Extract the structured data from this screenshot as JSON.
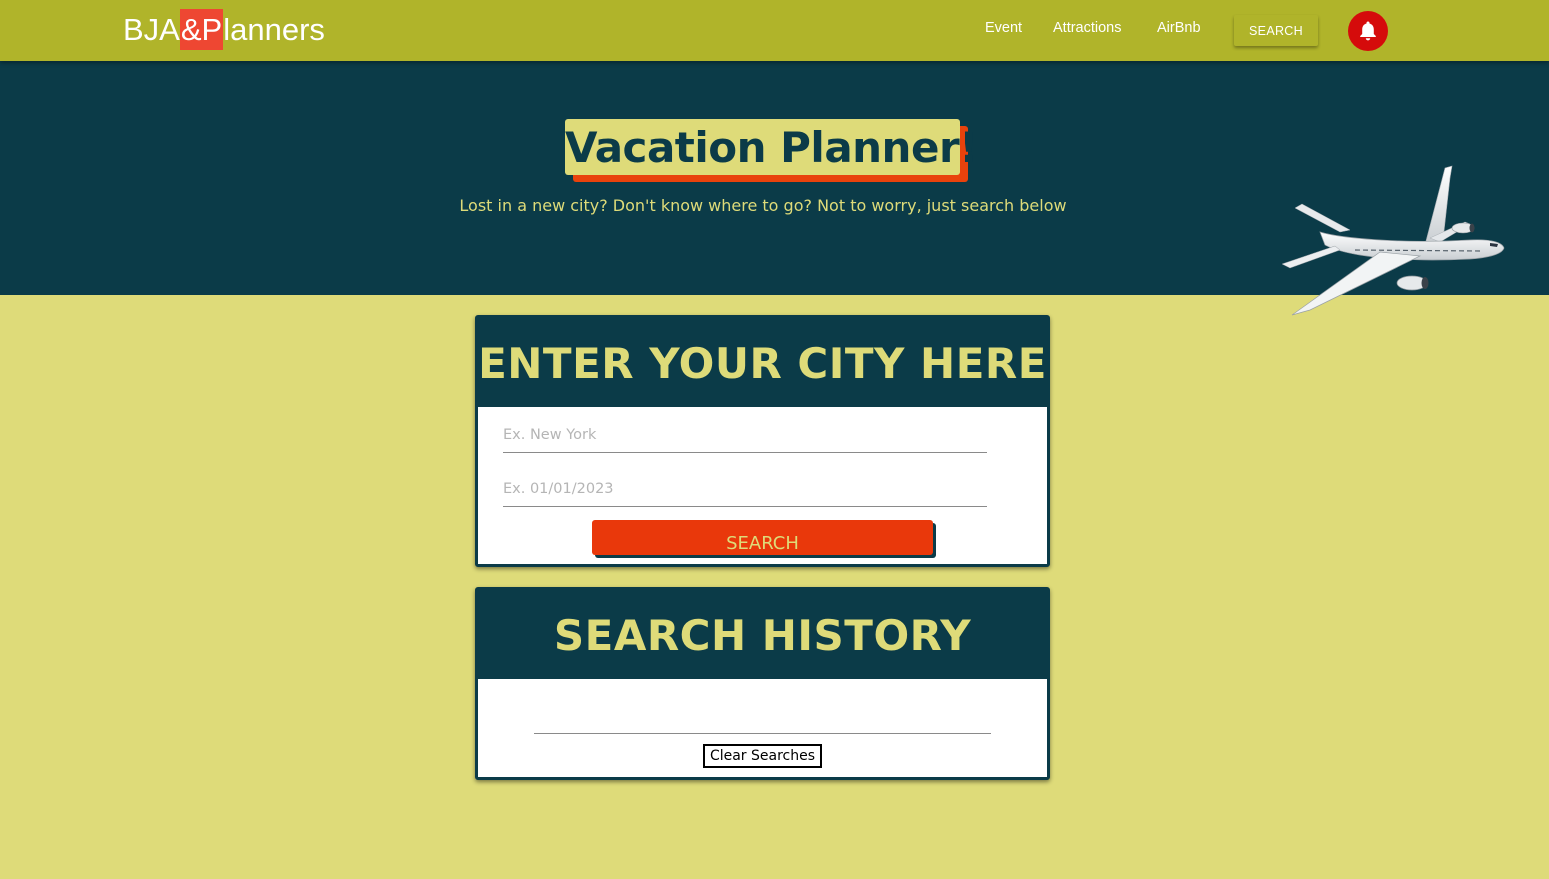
{
  "navbar": {
    "brand_prefix": "BJA",
    "brand_amp": "&P",
    "brand_suffix": "lanners",
    "links": [
      "Event",
      "Attractions",
      "AirBnb"
    ],
    "search_label": "SEARCH",
    "bell_icon": "bell-icon"
  },
  "hero": {
    "title": "Vacation Planner!",
    "subtitle": "Lost in a new city? Don't know where to go? Not to worry, just search below",
    "image": "airplane-image"
  },
  "city_card": {
    "heading": "ENTER YOUR CITY HERE",
    "city_placeholder": "Ex. New York",
    "city_value": "",
    "date_placeholder": "Ex. 01/01/2023",
    "date_value": "",
    "search_label": "SEARCH"
  },
  "history_card": {
    "heading": "SEARCH HISTORY",
    "items": [],
    "clear_label": "Clear Searches"
  },
  "colors": {
    "navbar": "#b0b42a",
    "hero": "#0b3b48",
    "page_bg": "#dedb79",
    "accent": "#e9380b",
    "brand_highlight": "#ee4732",
    "bell": "#d50b0b"
  }
}
